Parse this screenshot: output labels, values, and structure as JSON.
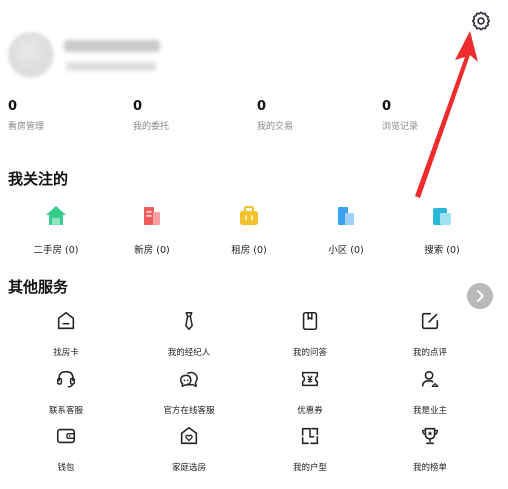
{
  "stats": [
    {
      "value": "0",
      "label": "看房管理"
    },
    {
      "value": "0",
      "label": "我的委托"
    },
    {
      "value": "0",
      "label": "我的交易"
    },
    {
      "value": "0",
      "label": "浏览记录"
    }
  ],
  "follow": {
    "title": "我关注的",
    "items": [
      {
        "label": "二手房 (0)",
        "icon": "house-icon",
        "color": "#33cc88"
      },
      {
        "label": "新房 (0)",
        "icon": "building-icon",
        "color": "#f25b5b"
      },
      {
        "label": "租房 (0)",
        "icon": "briefcase-icon",
        "color": "#f4c12a"
      },
      {
        "label": "小区 (0)",
        "icon": "tower-icon",
        "color": "#3aa0f2"
      },
      {
        "label": "搜索 (0)",
        "icon": "search-doc-icon",
        "color": "#2ab8d8"
      }
    ]
  },
  "services": {
    "title": "其他服务",
    "items": [
      {
        "label": "找房卡",
        "icon": "card-icon"
      },
      {
        "label": "我的经纪人",
        "icon": "tie-icon"
      },
      {
        "label": "我的问答",
        "icon": "bookmark-icon"
      },
      {
        "label": "我的点评",
        "icon": "edit-icon"
      },
      {
        "label": "联系客服",
        "icon": "headset-icon"
      },
      {
        "label": "官方在线客服",
        "icon": "chat-icon"
      },
      {
        "label": "优惠券",
        "icon": "coupon-icon"
      },
      {
        "label": "我是业主",
        "icon": "owner-icon"
      },
      {
        "label": "钱包",
        "icon": "wallet-icon"
      },
      {
        "label": "家庭选房",
        "icon": "home-heart-icon"
      },
      {
        "label": "我的户型",
        "icon": "floorplan-icon"
      },
      {
        "label": "我的榜单",
        "icon": "trophy-icon"
      }
    ]
  },
  "colors": {
    "accent": "#f02b2b",
    "gear": "#2b2f3a",
    "next_button": "#b9b9bb"
  }
}
